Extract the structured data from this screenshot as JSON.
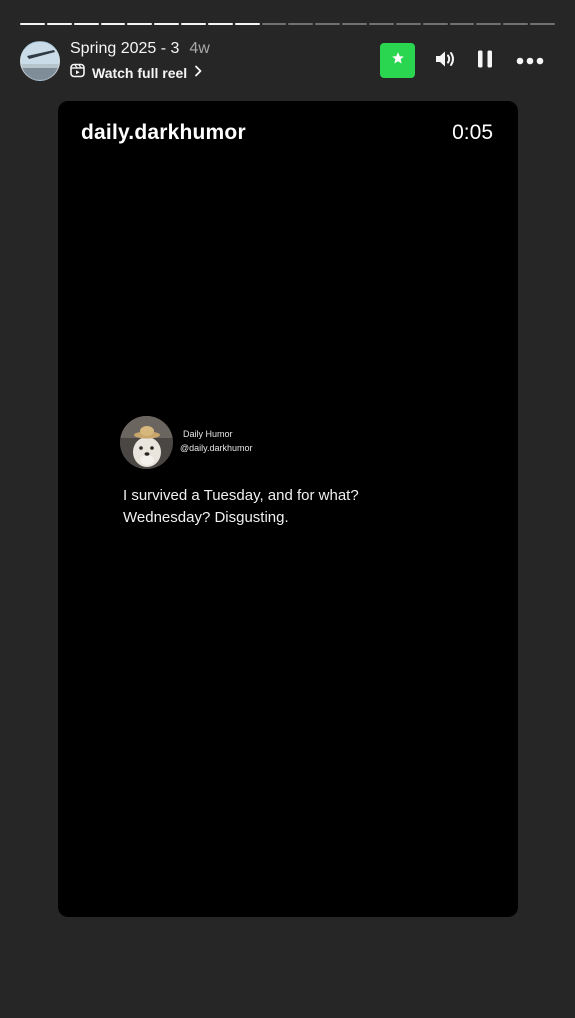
{
  "story": {
    "title": "Spring 2025 - 3",
    "age": "4w",
    "watch_full_reel": "Watch full reel",
    "progress": {
      "segments": 20,
      "completed": 9
    }
  },
  "controls": {
    "favorite_icon": "star-icon",
    "sound_icon": "speaker-icon",
    "pause_icon": "pause-icon",
    "more_icon": "more-icon",
    "accent_color": "#2ad64f"
  },
  "video": {
    "username": "daily.darkhumor",
    "timestamp": "0:05",
    "post": {
      "display_name": "Daily Humor",
      "handle": "@daily.darkhumor",
      "text": "I survived a Tuesday, and for what? Wednesday? Disgusting."
    }
  }
}
